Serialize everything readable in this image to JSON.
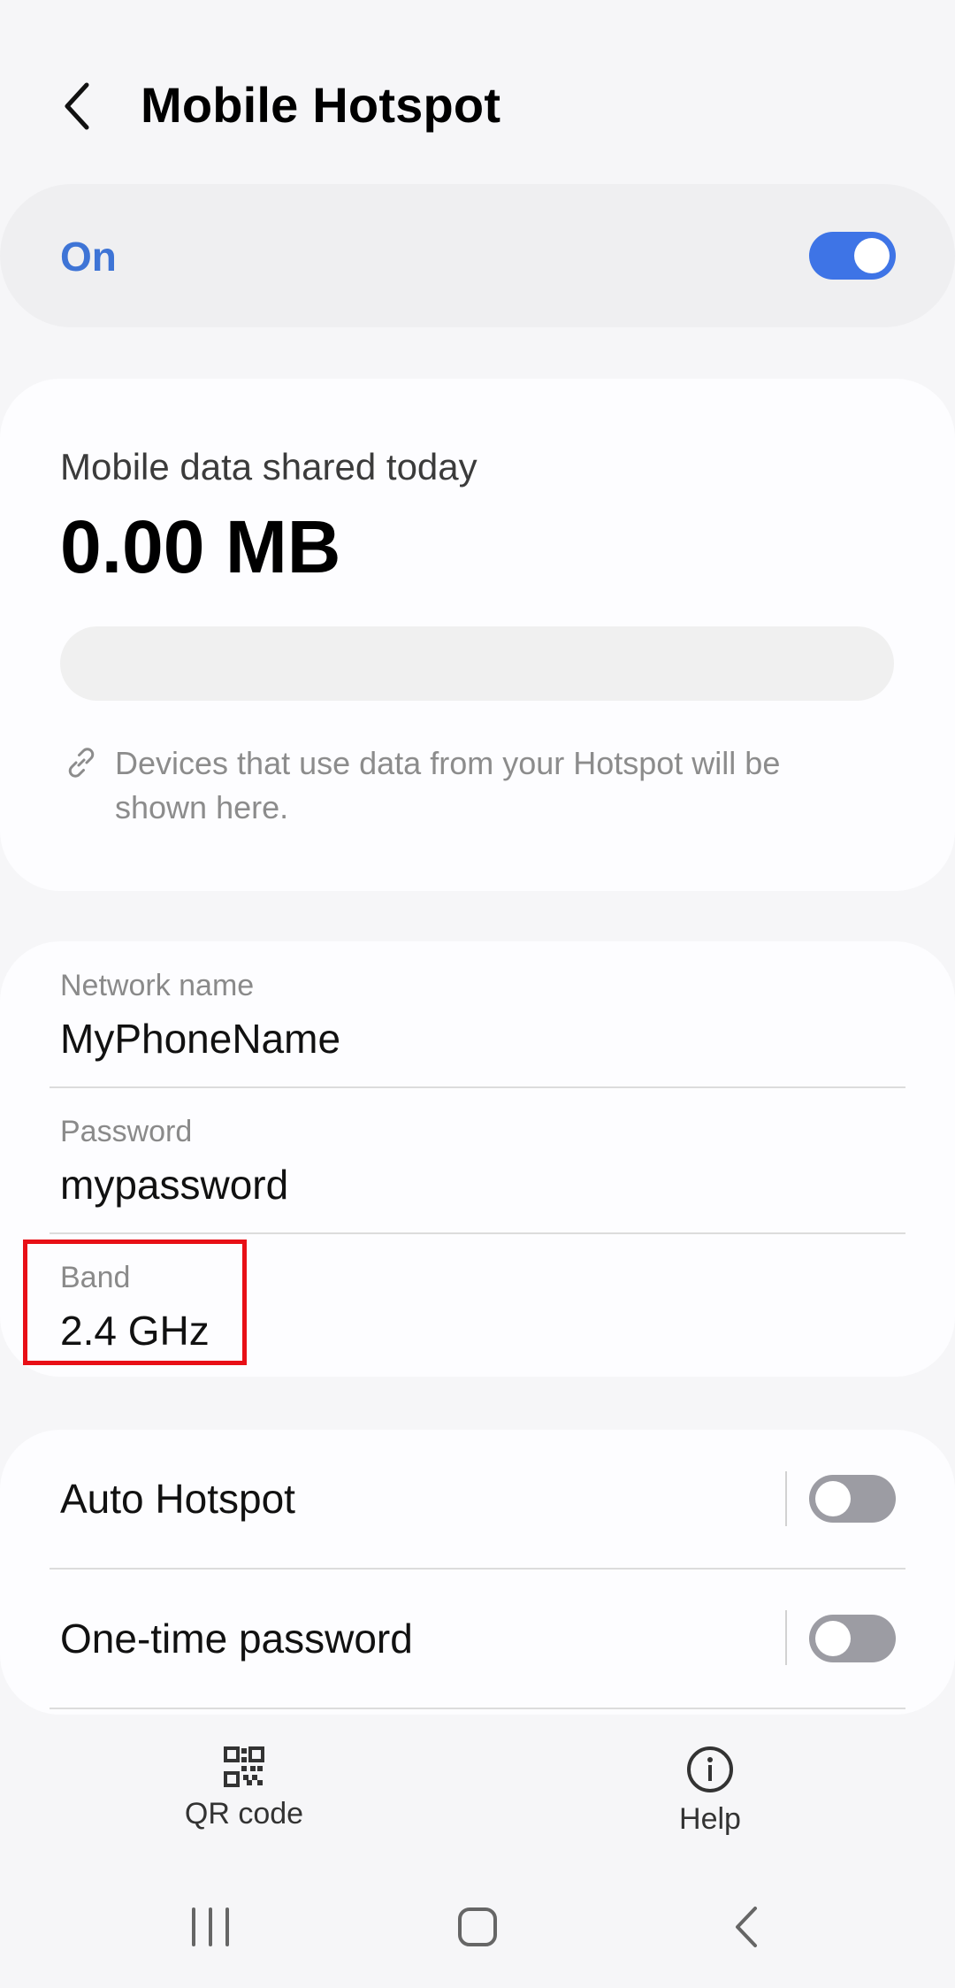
{
  "header": {
    "title": "Mobile Hotspot",
    "back_icon": "chevron-left-icon"
  },
  "master": {
    "label": "On",
    "enabled": true,
    "accent": "#3e74e6"
  },
  "usage": {
    "caption": "Mobile data shared today",
    "value": "0.00 MB",
    "progress_fraction": 0,
    "info_icon": "link-icon",
    "info_text": "Devices that use data from your Hotspot will be shown here."
  },
  "network": {
    "name_label": "Network name",
    "name_value": "MyPhoneName",
    "password_label": "Password",
    "password_value": "mypassword",
    "band_label": "Band",
    "band_value": "2.4 GHz",
    "highlight_color": "#e80f16"
  },
  "options": {
    "items": [
      {
        "label": "Auto Hotspot",
        "enabled": false
      },
      {
        "label": "One-time password",
        "enabled": false
      }
    ]
  },
  "bottom_actions": {
    "qr": {
      "label": "QR code",
      "icon": "qr-code-icon"
    },
    "help": {
      "label": "Help",
      "icon": "info-icon"
    }
  },
  "navbar": {
    "recents_icon": "recents-icon",
    "home_icon": "home-icon",
    "back_icon": "back-icon"
  }
}
